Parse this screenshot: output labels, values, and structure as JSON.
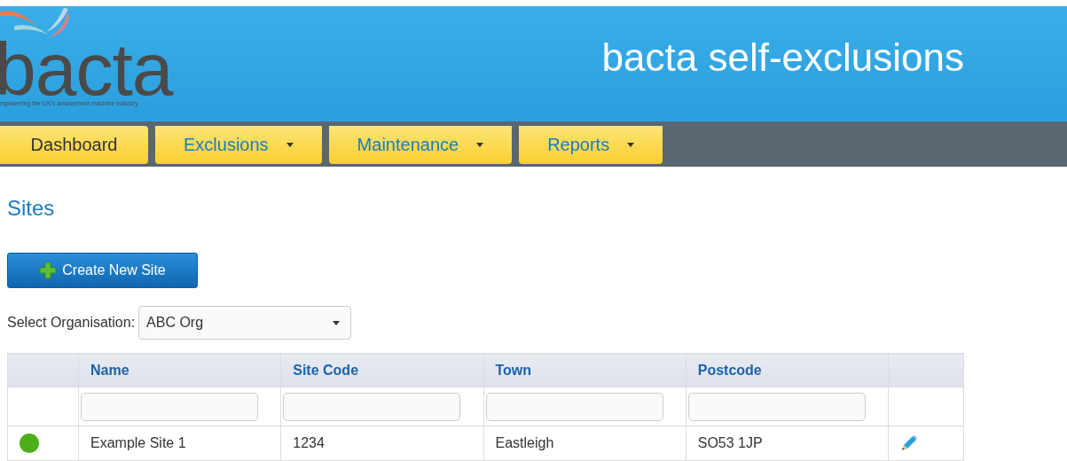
{
  "header": {
    "logo": "bacta",
    "tagline": "mpowering the UK's amusement machine industry",
    "title": "bacta self-exclusions"
  },
  "nav": [
    {
      "label": "Dashboard",
      "selected": true,
      "dropdown": false
    },
    {
      "label": "Exclusions",
      "selected": false,
      "dropdown": true
    },
    {
      "label": "Maintenance",
      "selected": false,
      "dropdown": true
    },
    {
      "label": "Reports",
      "selected": false,
      "dropdown": true
    }
  ],
  "page_title": "Sites",
  "create_button": "Create New Site",
  "organisation": {
    "label": "Select Organisation:",
    "value": "ABC Org"
  },
  "table": {
    "columns": [
      "Name",
      "Site Code",
      "Town",
      "Postcode"
    ],
    "rows": [
      {
        "color": "#4caf1a",
        "cells": [
          "Example Site 1",
          "1234",
          "Eastleigh",
          "SO53 1JP"
        ]
      }
    ]
  }
}
